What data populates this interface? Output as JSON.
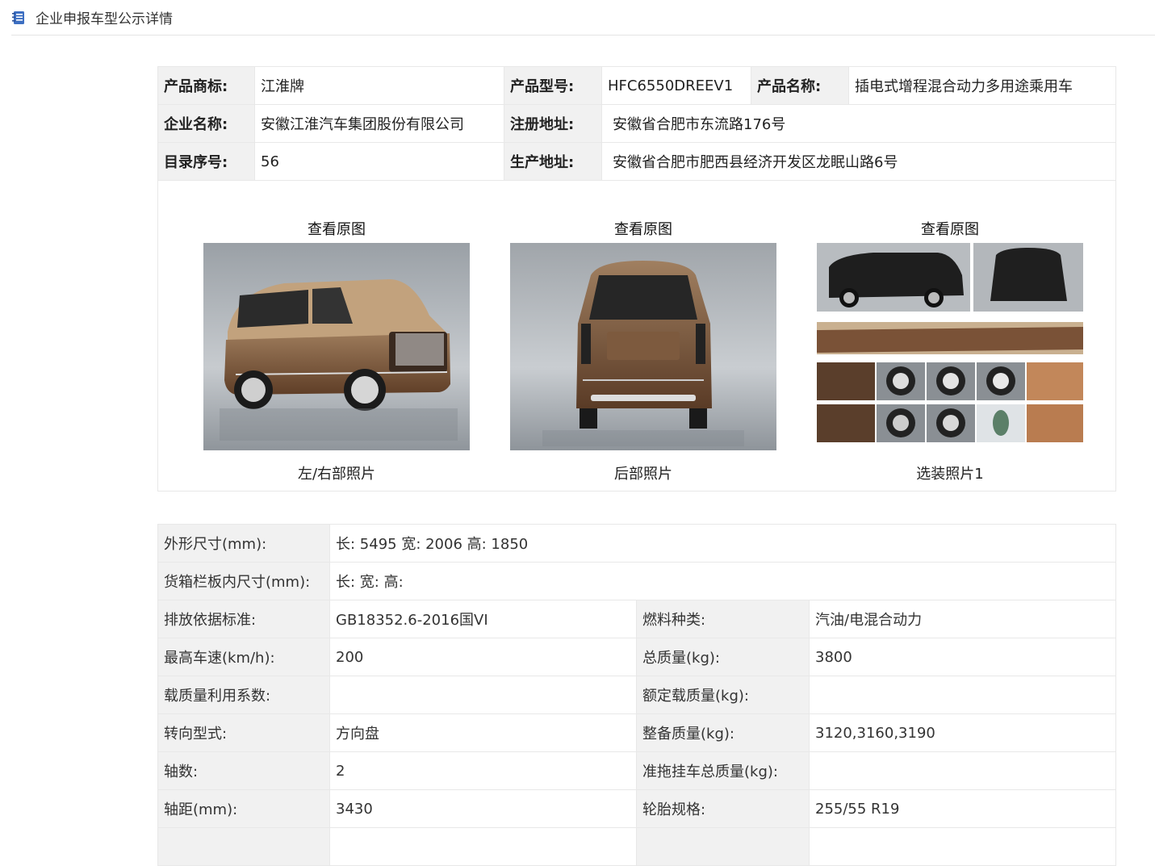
{
  "header": {
    "title": "企业申报车型公示详情",
    "icon": "notebook-icon"
  },
  "info": {
    "brand_label": "产品商标:",
    "brand": "江淮牌",
    "model_label": "产品型号:",
    "model": "HFC6550DREEV1",
    "name_label": "产品名称:",
    "name": "插电式增程混合动力多用途乘用车",
    "company_label": "企业名称:",
    "company": "安徽江淮汽车集团股份有限公司",
    "reg_addr_label": "注册地址:",
    "reg_addr": "安徽省合肥市东流路176号",
    "catalog_label": "目录序号:",
    "catalog": "56",
    "prod_addr_label": "生产地址:",
    "prod_addr": "安徽省合肥市肥西县经济开发区龙眠山路6号"
  },
  "photos": [
    {
      "view_link": "查看原图",
      "caption": "左/右部照片"
    },
    {
      "view_link": "查看原图",
      "caption": "后部照片"
    },
    {
      "view_link": "查看原图",
      "caption": "选装照片1"
    }
  ],
  "specs": {
    "dims_label": "外形尺寸(mm):",
    "dims": "长: 5495 宽: 2006 高: 1850",
    "cargo_label": "货箱栏板内尺寸(mm):",
    "cargo": "长:  宽:  高:",
    "emission_label": "排放依据标准:",
    "emission": "GB18352.6-2016国VI",
    "fuel_label": "燃料种类:",
    "fuel": "汽油/电混合动力",
    "speed_label": "最高车速(km/h):",
    "speed": "200",
    "mass_label": "总质量(kg):",
    "mass": "3800",
    "load_coef_label": "载质量利用系数:",
    "load_coef": "",
    "rated_load_label": "额定载质量(kg):",
    "rated_load": "",
    "steering_label": "转向型式:",
    "steering": "方向盘",
    "curb_label": "整备质量(kg):",
    "curb": "3120,3160,3190",
    "axles_label": "轴数:",
    "axles": "2",
    "trailer_label": "准拖挂车总质量(kg):",
    "trailer": "",
    "wheelbase_label": "轴距(mm):",
    "wheelbase": "3430",
    "tire_label": "轮胎规格:",
    "tire": "255/55 R19"
  },
  "colors": {
    "label_bg": "#f1f1f1",
    "border": "#e8e8e8",
    "car_brown": "#7a5237"
  }
}
